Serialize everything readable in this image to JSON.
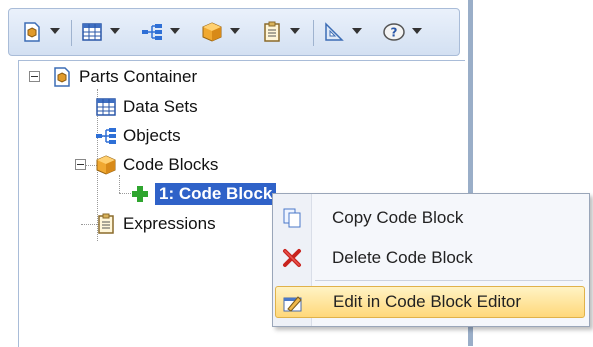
{
  "toolbar": {
    "buttons": [
      {
        "icon": "parts-container-icon"
      },
      {
        "icon": "data-set-grid-icon"
      },
      {
        "icon": "objects-tree-icon"
      },
      {
        "icon": "code-block-cube-icon"
      },
      {
        "icon": "expressions-clipboard-icon"
      },
      {
        "icon": "ruler-triangle-icon"
      },
      {
        "icon": "help-question-icon"
      }
    ]
  },
  "tree": {
    "root": "Parts Container",
    "items": [
      {
        "label": "Data Sets"
      },
      {
        "label": "Objects"
      },
      {
        "label": "Code Blocks"
      },
      {
        "label": "1: Code Block"
      },
      {
        "label": "Expressions"
      }
    ]
  },
  "context_menu": {
    "items": [
      {
        "label": "Copy Code Block"
      },
      {
        "label": "Delete Code Block"
      },
      {
        "label": "Edit in Code Block Editor"
      }
    ]
  },
  "colors": {
    "selection": "#2f62c8",
    "hover_top": "#fff3c4",
    "hover_bottom": "#ffd87a",
    "frame": "#9aaec8"
  }
}
